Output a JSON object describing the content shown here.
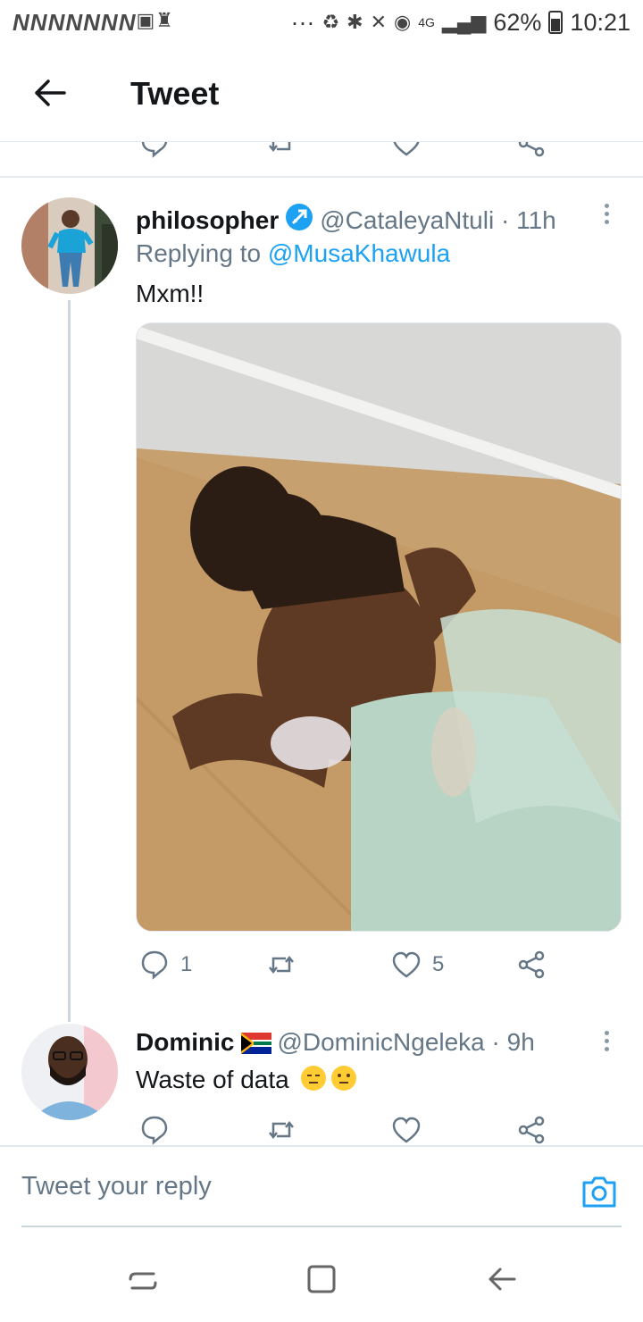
{
  "status_bar": {
    "notifications": [
      "N",
      "N",
      "N",
      "N",
      "N",
      "N",
      "N"
    ],
    "dots": "···",
    "signal": "4G",
    "battery": "62%",
    "battery_level": 0.62,
    "time": "10:21"
  },
  "header": {
    "title": "Tweet"
  },
  "tweets": [
    {
      "name": "philosopher",
      "handle": "@CataleyaNtuli",
      "time": "· 11h",
      "replying_prefix": "Replying to",
      "replying_handle": "@MusaKhawula",
      "text": "Mxm!!",
      "actions": {
        "replies": "1",
        "retweets": "",
        "likes": "5"
      }
    },
    {
      "name": "Dominic",
      "handle": "@DominicNgeleka",
      "time": "· 9h",
      "text": "Waste of data",
      "emojis": [
        "expressionless-face",
        "neutral-face"
      ],
      "actions": {
        "replies": "",
        "retweets": "",
        "likes": ""
      }
    }
  ],
  "reply_bar": {
    "placeholder": "Tweet your reply"
  },
  "colors": {
    "twitter_blue": "#1da1f2",
    "muted": "#657786",
    "divider": "#e1e8ed"
  },
  "icons": [
    "back-arrow-icon",
    "verified-icon",
    "more-icon",
    "reply-icon",
    "retweet-icon",
    "like-icon",
    "share-icon",
    "camera-icon",
    "flag-icon"
  ]
}
